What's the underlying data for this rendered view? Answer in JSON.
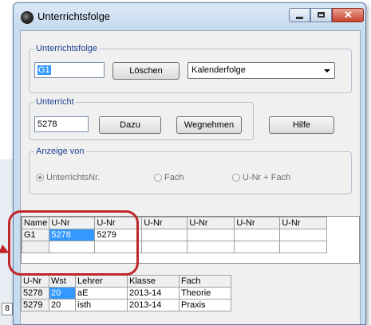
{
  "window": {
    "title": "Unterrichtsfolge"
  },
  "bg": {
    "cell_text": "8"
  },
  "unterrichtsfolge_group": {
    "label": "Unterrichtsfolge",
    "value": "G1",
    "delete_label": "Löschen",
    "combo_value": "Kalenderfolge"
  },
  "unterricht_group": {
    "label": "Unterricht",
    "value": "5278",
    "add_label": "Dazu",
    "remove_label": "Wegnehmen",
    "help_label": "Hilfe"
  },
  "anzeige_group": {
    "label": "Anzeige von",
    "options": [
      "UnterrichtsNr.",
      "Fach",
      "U-Nr + Fach"
    ],
    "selected_index": 0
  },
  "sequence_grid": {
    "headers": [
      "Name",
      "U-Nr",
      "U-Nr",
      "U-Nr",
      "U-Nr",
      "U-Nr",
      "U-Nr"
    ],
    "rows": [
      [
        "G1",
        "5278",
        "5279",
        "",
        "",
        "",
        ""
      ],
      [
        "",
        "",
        "",
        "",
        "",
        "",
        ""
      ]
    ]
  },
  "detail_grid": {
    "headers": [
      "U-Nr",
      "Wst",
      "Lehrer",
      "Klasse",
      "Fach"
    ],
    "rows": [
      [
        "5278",
        "20",
        "aE",
        "2013-14",
        "Theorie"
      ],
      [
        "5279",
        "20",
        "isth",
        "2013-14",
        "Praxis"
      ]
    ]
  },
  "colors": {
    "highlight_ring": "#c0262c",
    "selection": "#3399ff",
    "group_label": "#1a3f8f"
  }
}
